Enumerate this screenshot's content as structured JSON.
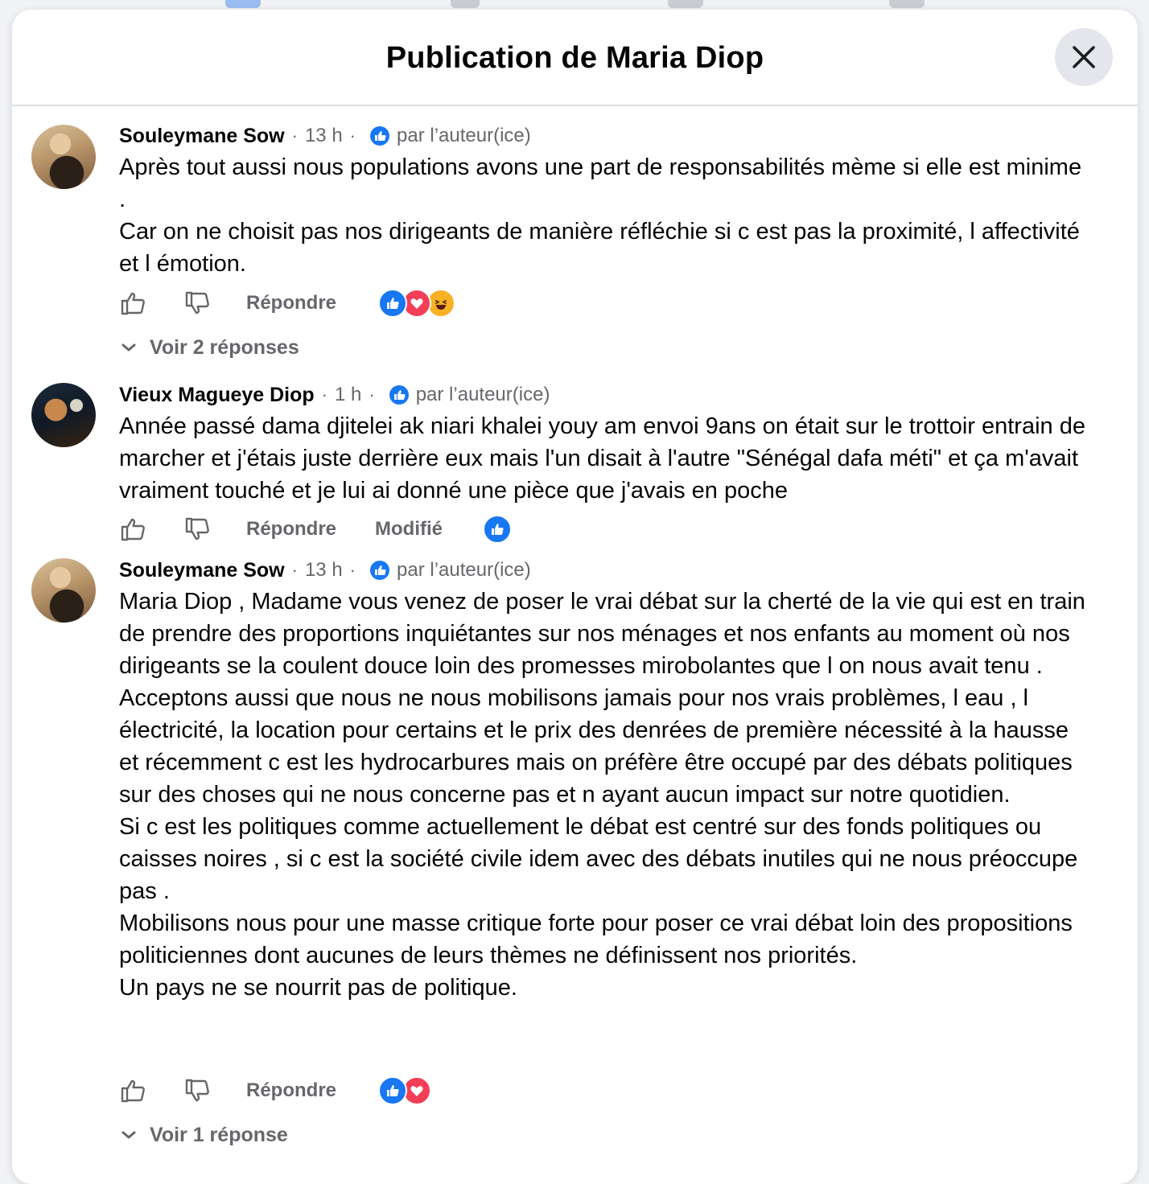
{
  "modal": {
    "title": "Publication de Maria Diop",
    "close_icon": "close-icon"
  },
  "comments": [
    {
      "author": "Souleymane Sow",
      "time": "13 h",
      "byline": "par l’auteur(ice)",
      "text": "Après tout aussi nous populations avons une part de responsabilités mème si elle est minime .\nCar on ne choisit pas nos dirigeants de manière réfléchie si c est pas la proximité, l affectivité et l émotion.",
      "reply_label": "Répondre",
      "reactions": [
        "like",
        "love",
        "haha"
      ],
      "see_replies": "Voir 2 réponses"
    },
    {
      "author": "Vieux Magueye Diop",
      "time": "1 h",
      "byline": "par l’auteur(ice)",
      "text": "Année passé dama djitelei ak niari khalei youy am envoi 9ans on était sur le trottoir entrain de marcher et j'étais juste derrière eux mais l'un disait à l'autre \"Sénégal dafa méti\" et ça m'avait vraiment touché et je lui ai donné une pièce que j'avais en poche",
      "reply_label": "Répondre",
      "edited_label": "Modifié",
      "reactions": [
        "like"
      ]
    },
    {
      "author": "Souleymane Sow",
      "time": "13 h",
      "byline": "par l’auteur(ice)",
      "text": "Maria Diop , Madame vous venez de poser le vrai débat sur la cherté de la vie qui est en train de prendre des proportions inquiétantes sur nos ménages et nos enfants au moment où nos dirigeants se la coulent douce loin des promesses mirobolantes que l on nous avait tenu .\nAcceptons aussi que nous ne nous mobilisons jamais pour nos vrais problèmes, l eau , l électricité, la location pour certains et le prix des denrées de première nécessité à la hausse et récemment c est les hydrocarbures mais on préfère être occupé par des débats politiques sur des choses qui ne nous concerne pas et n ayant aucun impact sur notre quotidien.\nSi c est les politiques comme actuellement le débat est centré sur des fonds politiques ou caisses noires , si c est la société civile idem avec des débats inutiles qui ne nous préoccupe pas .\nMobilisons nous pour une masse critique forte pour poser ce vrai débat loin des propositions politiciennes dont aucunes de leurs thèmes ne définissent nos priorités.\nUn pays ne se nourrit pas de politique.",
      "reply_label": "Répondre",
      "reactions": [
        "like",
        "love"
      ],
      "see_replies": "Voir 1 réponse"
    }
  ],
  "colors": {
    "accent": "#1877f2",
    "love": "#f33e58",
    "haha": "#f7b125",
    "secondary_text": "#65676b",
    "backdrop": "#f0f2f5"
  }
}
